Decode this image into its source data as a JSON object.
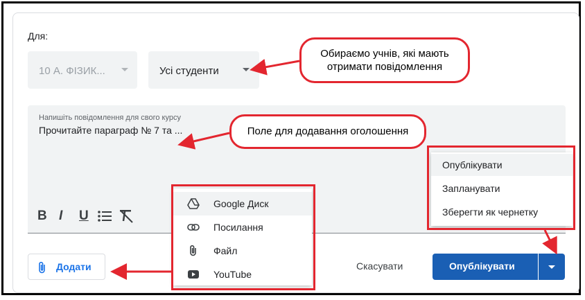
{
  "form": {
    "for_label": "Для:",
    "class_select": "10 А. ФІЗИК...",
    "students_select": "Усі студенти"
  },
  "message": {
    "placeholder": "Напишіть повідомлення для свого курсу",
    "value": "Прочитайте параграф № 7 та ..."
  },
  "toolbar": {
    "bold": "B",
    "italic": "I",
    "underline": "U",
    "list_icon": "bulleted-list-icon",
    "clear_format_icon": "clear-format-icon"
  },
  "attach_menu": {
    "items": [
      {
        "label": "Google Диск",
        "icon": "google-drive-icon"
      },
      {
        "label": "Посилання",
        "icon": "link-icon"
      },
      {
        "label": "Файл",
        "icon": "paperclip-icon"
      },
      {
        "label": "YouTube",
        "icon": "youtube-icon"
      }
    ]
  },
  "actions": {
    "add_label": "Додати",
    "cancel_label": "Скасувати",
    "publish_label": "Опублікувати"
  },
  "publish_menu": {
    "items": [
      "Опублікувати",
      "Запланувати",
      "Зберегти як чернетку"
    ]
  },
  "annotations": {
    "callout_students": "Обираємо учнів, які мають отримати повідомлення",
    "callout_field": "Поле для додавання оголошення"
  },
  "colors": {
    "accent_blue": "#1a5fb4",
    "link_blue": "#1a73e8",
    "annotation_red": "#e3262f"
  }
}
